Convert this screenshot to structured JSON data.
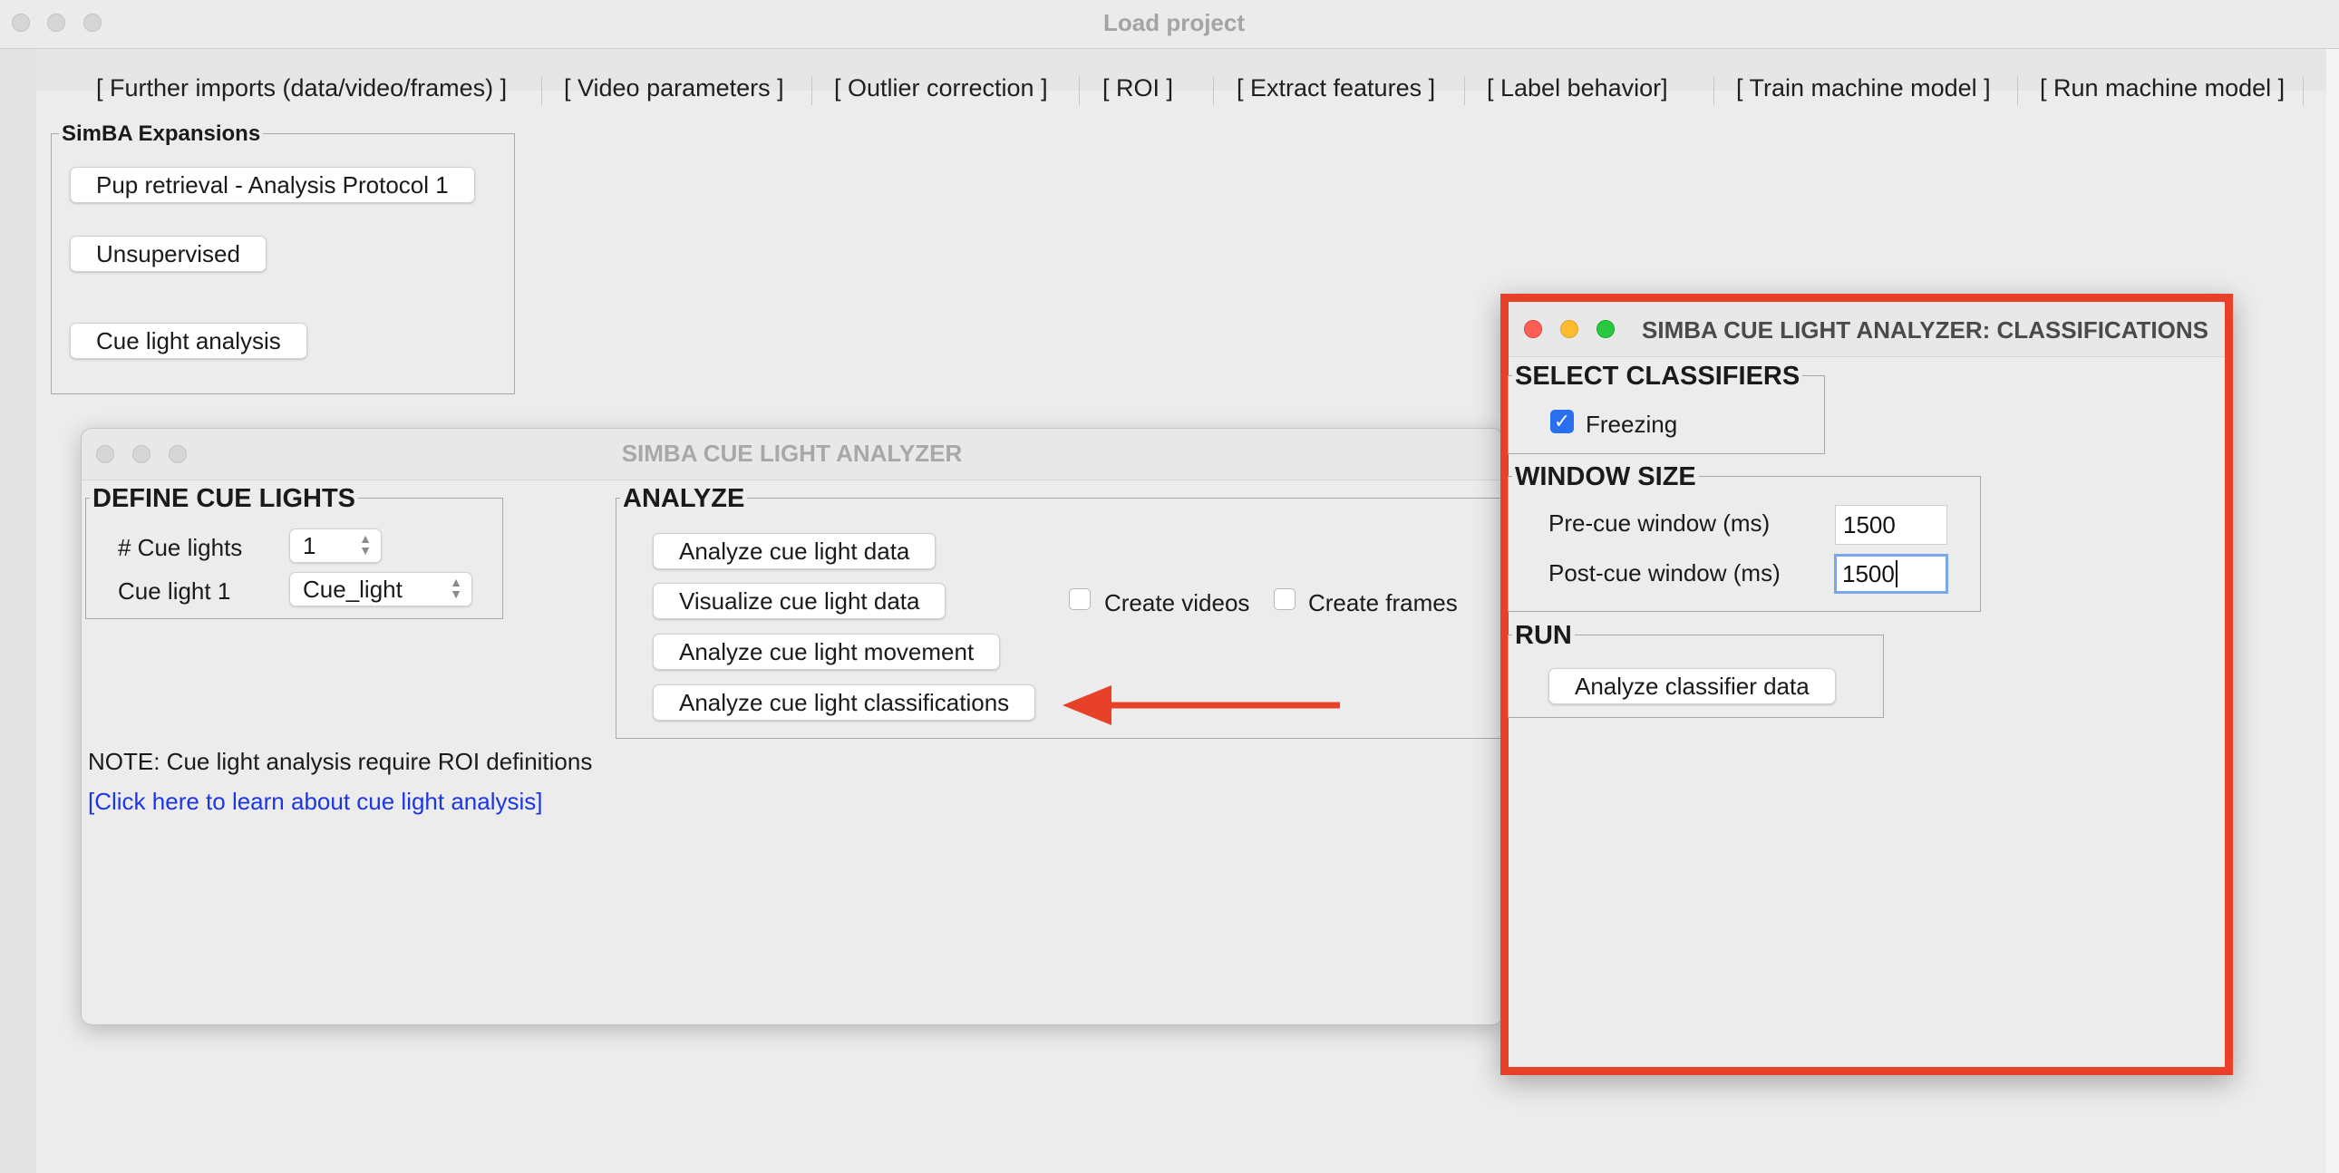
{
  "window": {
    "title": "Load project"
  },
  "tabs": [
    "[ Further imports (data/video/frames) ]",
    "[ Video parameters ]",
    "[ Outlier correction ]",
    "[ ROI ]",
    "[ Extract features ]",
    "[ Label behavior]",
    "[ Train machine model ]",
    "[ Run machine model ]"
  ],
  "expansions": {
    "title": "SimBA Expansions",
    "buttons": [
      "Pup retrieval - Analysis Protocol 1",
      "Unsupervised",
      "Cue light analysis"
    ]
  },
  "cue_light_window": {
    "title": "SIMBA CUE LIGHT ANALYZER",
    "define": {
      "title": "DEFINE CUE LIGHTS",
      "count_label": "# Cue lights",
      "count_value": "1",
      "light1_label": "Cue light 1",
      "light1_value": "Cue_light"
    },
    "analyze": {
      "title": "ANALYZE",
      "buttons": [
        "Analyze cue light data",
        "Visualize cue light data",
        "Analyze cue light movement",
        "Analyze cue light classifications"
      ],
      "create_videos_label": "Create videos",
      "create_videos_checked": false,
      "create_frames_label": "Create frames",
      "create_frames_checked": false
    },
    "note": "NOTE: Cue light analysis require ROI definitions",
    "link": "[Click here to learn about cue light analysis]",
    "annotation_arrow_color": "#e8412a"
  },
  "classifications_window": {
    "title": "SIMBA CUE LIGHT ANALYZER: CLASSIFICATIONS",
    "highlight_color": "#e8412a",
    "select": {
      "title": "SELECT CLASSIFIERS",
      "classifier_label": "Freezing",
      "classifier_checked": true
    },
    "window_size": {
      "title": "WINDOW SIZE",
      "pre_label": "Pre-cue window (ms)",
      "pre_value": "1500",
      "post_label": "Post-cue window (ms)",
      "post_value": "1500"
    },
    "run": {
      "title": "RUN",
      "button": "Analyze classifier data"
    }
  }
}
